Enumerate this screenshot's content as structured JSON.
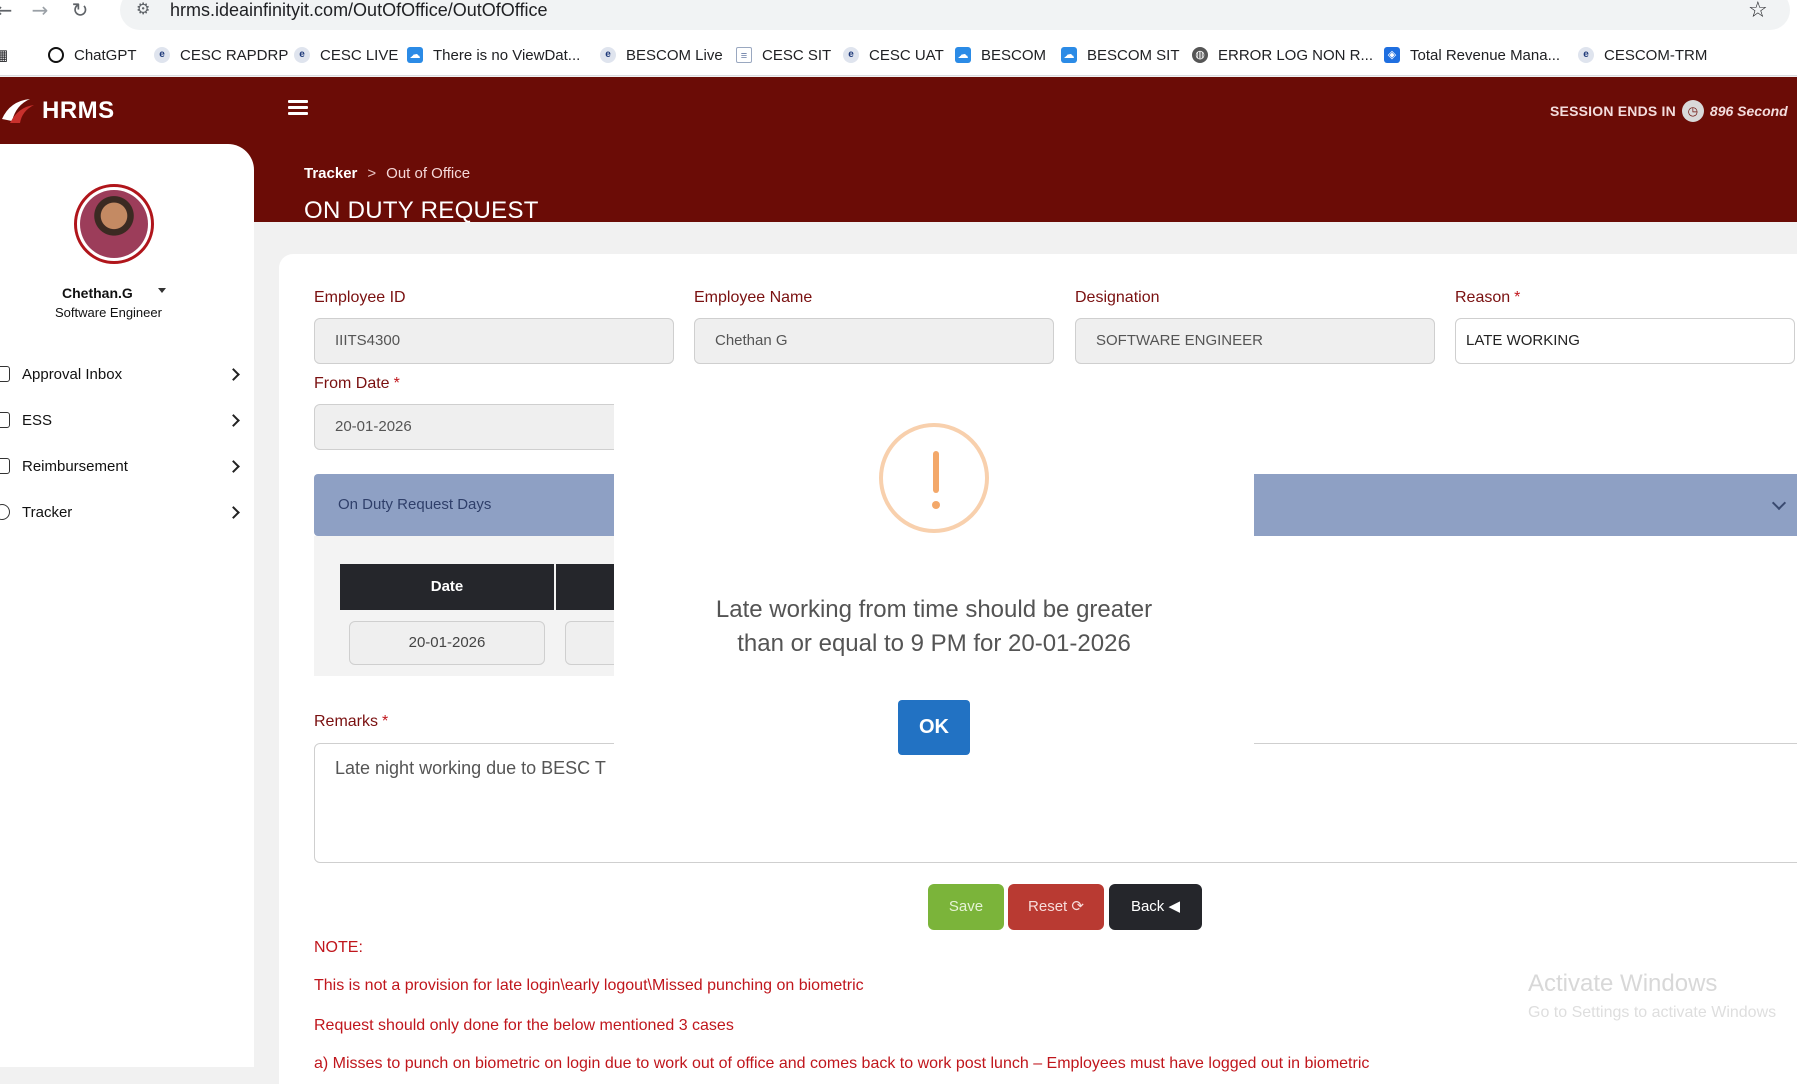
{
  "browser": {
    "url": "hrms.ideainfinityit.com/OutOfOffice/OutOfOffice",
    "bookmarks": [
      {
        "label": "ChatGPT"
      },
      {
        "label": "CESC RAPDRP"
      },
      {
        "label": "CESC LIVE"
      },
      {
        "label": "There is no ViewDat..."
      },
      {
        "label": "BESCOM Live"
      },
      {
        "label": "CESC SIT"
      },
      {
        "label": "CESC UAT"
      },
      {
        "label": "BESCOM"
      },
      {
        "label": "BESCOM SIT"
      },
      {
        "label": "ERROR LOG NON R..."
      },
      {
        "label": "Total Revenue Mana..."
      },
      {
        "label": "CESCOM-TRM"
      }
    ]
  },
  "header": {
    "app_name": "HRMS",
    "session_label": "SESSION ENDS IN",
    "session_value": "896 Second"
  },
  "breadcrumb": {
    "root": "Tracker",
    "separator": ">",
    "current": "Out of Office"
  },
  "page_title": "ON DUTY REQUEST",
  "sidebar": {
    "user_name": "Chethan.G",
    "user_role": "Software Engineer",
    "items": [
      {
        "label": "Approval Inbox"
      },
      {
        "label": "ESS"
      },
      {
        "label": "Reimbursement"
      },
      {
        "label": "Tracker"
      }
    ]
  },
  "form": {
    "employee_id": {
      "label": "Employee ID",
      "value": "IIITS4300"
    },
    "employee_name": {
      "label": "Employee Name",
      "value": "Chethan G"
    },
    "designation": {
      "label": "Designation",
      "value": "SOFTWARE ENGINEER"
    },
    "reason": {
      "label": "Reason",
      "value": "LATE WORKING"
    },
    "from_date": {
      "label": "From Date",
      "value": "20-01-2026"
    },
    "required_marker": "*",
    "days_section": "On Duty Request Days",
    "days_table": {
      "header_date": "Date",
      "row_date": "20-01-2026"
    },
    "remarks": {
      "label": "Remarks",
      "value": "Late night working due to BESC T"
    }
  },
  "buttons": {
    "save": "Save",
    "reset": "Reset",
    "back": "Back"
  },
  "notes": {
    "title": "NOTE:",
    "line1": "This is not a provision for late login\\early logout\\Missed punching on biometric",
    "line2": "Request should only done for the below mentioned 3 cases",
    "line3": "a) Misses to punch on biometric on login due to work out of office and comes back to work post lunch – Employees must have logged out in biometric"
  },
  "watermark": {
    "title": "Activate Windows",
    "subtitle": "Go to Settings to activate Windows"
  },
  "modal": {
    "message_line1": "Late working from time should be greater",
    "message_line2": "than or equal to 9 PM for 20-01-2026",
    "ok": "OK"
  },
  "colors": {
    "header_bg": "#6b0c06",
    "label_text": "#7a1010",
    "note_text": "#c0161c",
    "ok_button": "#2272c3",
    "warning_icon": "#f3a86a"
  }
}
